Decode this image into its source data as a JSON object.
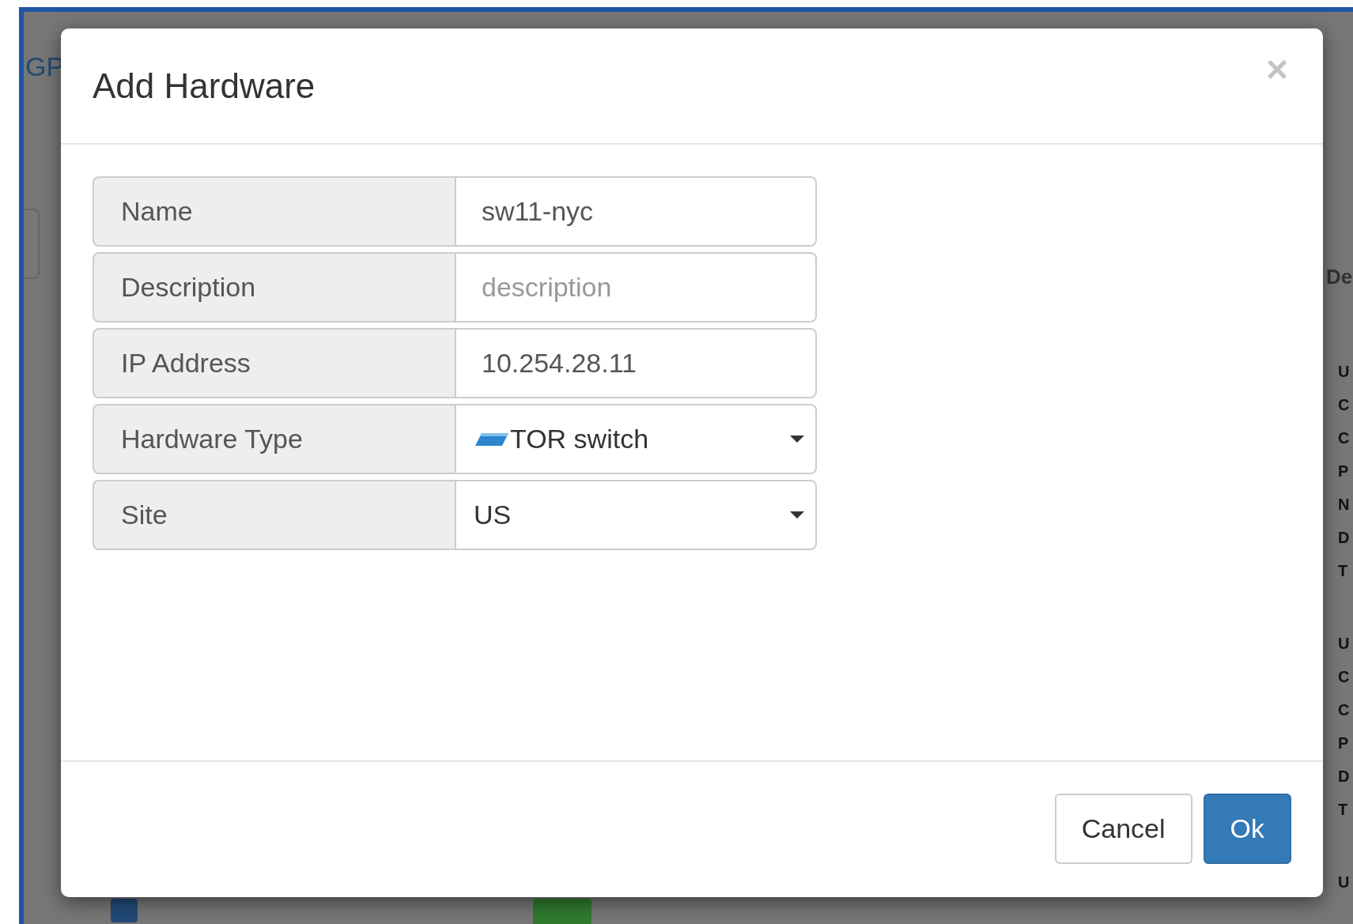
{
  "background": {
    "heading_fragment": "GP",
    "column_heading_fragment": "De",
    "letter_groups": [
      [
        "U",
        "C",
        "C",
        "P",
        "N",
        "D",
        "T"
      ],
      [
        "U",
        "C",
        "C",
        "P",
        "D",
        "T"
      ],
      [
        "U"
      ]
    ]
  },
  "dialog": {
    "title": "Add Hardware",
    "close": "×",
    "fields": [
      {
        "kind": "input",
        "label": "Name",
        "value": "sw11-nyc"
      },
      {
        "kind": "input",
        "label": "Description",
        "placeholder": "description"
      },
      {
        "kind": "input",
        "label": "IP Address",
        "value": "10.254.28.11"
      },
      {
        "kind": "select",
        "label": "Hardware Type",
        "value": "TOR switch",
        "icon": true
      },
      {
        "kind": "select",
        "label": "Site",
        "value": "US"
      }
    ],
    "buttons": [
      {
        "label": "Cancel",
        "primary": false
      },
      {
        "label": "Ok",
        "primary": true
      }
    ]
  }
}
